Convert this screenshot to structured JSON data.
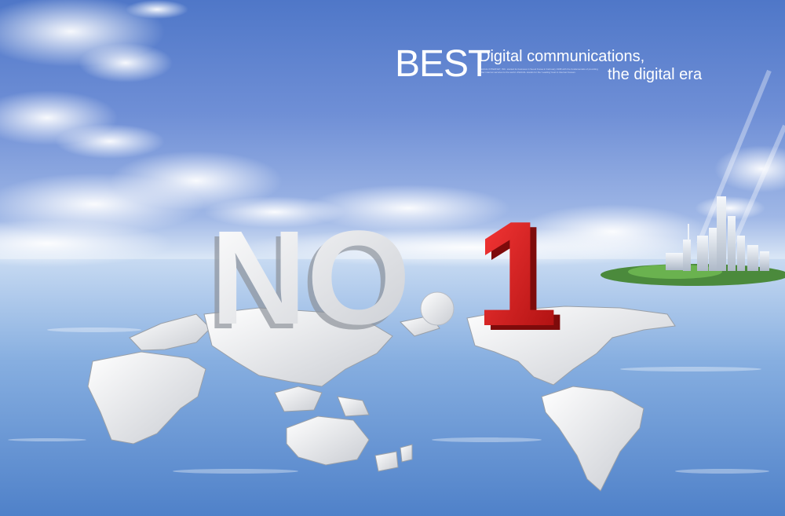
{
  "headline": {
    "best": "BEST",
    "line1": "Digital communications,",
    "line2": "the digital era",
    "fineprint": "ASACAL INTERNET, INC. started its business in Seoul Korea in February 1998 with the fundamentals of providing better internet services to the world. ASACAL stands for the 'Leading' best in internet Korean."
  },
  "hero": {
    "no": "NO",
    "one": "1"
  },
  "colors": {
    "sky_top": "#4f77c8",
    "sea": "#6f98d8",
    "accent_red": "#d11f1f",
    "map_white": "#f2f3f5"
  }
}
